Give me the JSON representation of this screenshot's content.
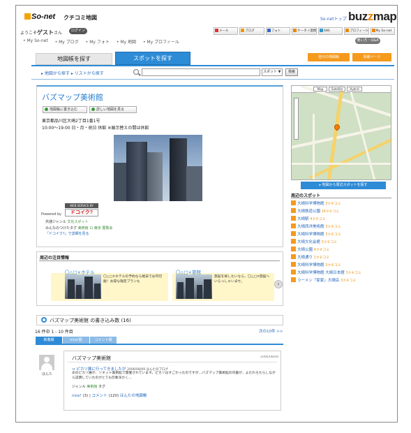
{
  "header": {
    "logo_text": "So-net",
    "logo_sub": "クチコミ地図",
    "top_link": "So-netトップ",
    "brand": "buzzmap",
    "brand_sup": "So-net"
  },
  "welcome": {
    "prefix": "ようこそ",
    "user": "ゲスト",
    "suffix": "さん",
    "login": "ログイン"
  },
  "services": [
    "メール",
    "ブログ",
    "フォト",
    "ケータイ連携",
    "SNS",
    "プロフィール",
    "My So-net"
  ],
  "mynav": [
    "• My So-net",
    "• My ブログ",
    "• My フォト",
    "• My 地図",
    "• My プロフィール"
  ],
  "help_label": "使い方・Q&A",
  "tabs": {
    "map_search": "地図帳を探す",
    "spot_search": "スポットを探す"
  },
  "buttons": {
    "my_map": "自分の地図帳",
    "fav": "情報ページ"
  },
  "sublinks": "▸ 地図から探す  ▸ リストから探す",
  "search": {
    "placeholder": "",
    "select": "スポット ▼",
    "button": "検索"
  },
  "spot": {
    "title": "バズマップ美術館",
    "action_write": "地図帳に書き込む",
    "action_detail": "詳しい地図を見る",
    "address": "東京都品川区大崎2丁目1番1号",
    "hours": "10:00〜19:00 日・月・祝日 休館 ※展示替えの間は休館",
    "ws_label": "WEB SERVICE BY",
    "powered": "Powered by",
    "dokoiku": "ドコイク?",
    "genre_label": "共通ジャンル",
    "genre_value": "文化スポット",
    "tags_label": "みんなのつけたタグ",
    "tags_value": "美術館 ロ 東京 展覧会",
    "doko_link": "「ドコイク?」で詳細を見る"
  },
  "attention": {
    "title": "周辺の注目情報",
    "card1_title": "〇△□×ホテル",
    "card1_text": "〇△□×ホテルの予約なら格安でお円可能！お得な限定プランも",
    "card2_title": "〇△□×旅館",
    "card2_text": "旅館を探したいなら、〇△□×旅館へいらっしゃいませ。",
    "next": "›"
  },
  "reviews": {
    "header": "バズマップ美術館 の書き込み数 (16)",
    "count": "16 件中 1 - 10 件目",
    "next": "次の10件 >>",
    "tabs": [
      "新着順",
      "nice!順",
      "コメント順"
    ],
    "user": "ほんた",
    "spot": "バズマップ美術館",
    "date": "2006/08/09",
    "blog_title": "ピカソ展に行ってきましたが",
    "blog_meta": "2006/08/09  ほんたのブログ",
    "body": "あのピカソ展が、ソネット美術館で開催されています。ピカソはすごかったのですが…バズマップ美術館の司書が、よたわろたらしながら説明していたのがとても印象深かく…",
    "genre_label": "ジャンル",
    "genre_value": "美術館",
    "genre_extra": "タグ",
    "foot_nice": "nice!",
    "foot_nice_count": "(3)",
    "foot_comment": "コメント",
    "foot_comment_count": "(120)",
    "foot_map": "ほんたの地図帳"
  },
  "map": {
    "type1": "Map",
    "type2": "Satellite",
    "type3": "Hybrid",
    "button": "▸ 地図から周辺スポットを探す",
    "near_title": "周辺のスポット",
    "near_items": [
      {
        "name": "大崎科学博物館",
        "cnt": "3クチコミ"
      },
      {
        "name": "大崎鉄道公園",
        "cnt": "16クチコミ"
      },
      {
        "name": "大崎駅",
        "cnt": "4クチコミ"
      },
      {
        "name": "大崎西洋美術館",
        "cnt": "3クチコミ"
      },
      {
        "name": "大崎科学博物館",
        "cnt": "3クチコミ"
      },
      {
        "name": "大崎文化会館",
        "cnt": "3クチコミ"
      },
      {
        "name": "大崎公園",
        "cnt": "4クチコミ"
      },
      {
        "name": "大崎通り",
        "cnt": "1クチコミ"
      },
      {
        "name": "大崎科学博物館",
        "cnt": "3クチコミ"
      },
      {
        "name": "大崎科学博物館 大崎日本館",
        "cnt": "3クチコミ"
      },
      {
        "name": "ラーメン「家家」大崎店",
        "cnt": "3クチコミ"
      }
    ]
  },
  "colors": {
    "accent": "#2e8bd6",
    "orange": "#f59a1d",
    "link": "#2266bb"
  }
}
